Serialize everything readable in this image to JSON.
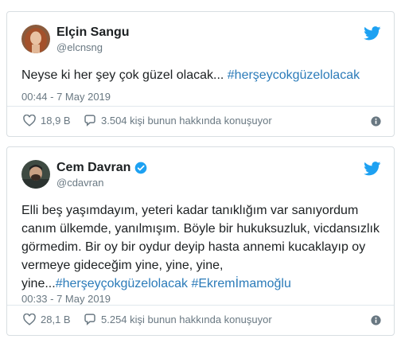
{
  "tweets": [
    {
      "display_name": "Elçin Sangu",
      "handle": "@elcnsng",
      "text": "Neyse ki her şey çok güzel olacak... ",
      "hashtag_1": "#herşeycokgüzelolacak",
      "timestamp": "00:44 - 7 May 2019",
      "likes": "18,9 B",
      "talking": "3.504 kişi bunun hakkında konuşuyor",
      "verified": false
    },
    {
      "display_name": "Cem Davran",
      "handle": "@cdavran",
      "line_1": "Elli beş yaşımdayım, yeteri kadar tanıklığım var sanıyordum",
      "line_2": "canım ülkemde, yanılmışım. Böyle bir hukuksuzluk, vicdansızlık",
      "line_3": "görmedim. Bir oy bir oydur deyip hasta annemi kucaklayıp oy",
      "line_4": "vermeye gideceğim yine, yine, yine,",
      "line_5_prefix": "yine...",
      "hashtag_1": "#herşeyçokgüzelolacak",
      "hashtag_2": "#Ekremİmamoğlu",
      "timestamp": "00:33 - 7 May 2019",
      "likes": "28,1 B",
      "talking": "5.254 kişi bunun hakkında konuşuyor",
      "verified": true
    }
  ],
  "colors": {
    "accent": "#1da1f2",
    "hashtag": "#2b7bb9",
    "muted": "#697882",
    "border": "#d8dee2"
  },
  "icons": [
    "twitter-bird-icon",
    "heart-icon",
    "speech-bubble-icon",
    "info-icon",
    "verified-badge-icon"
  ]
}
